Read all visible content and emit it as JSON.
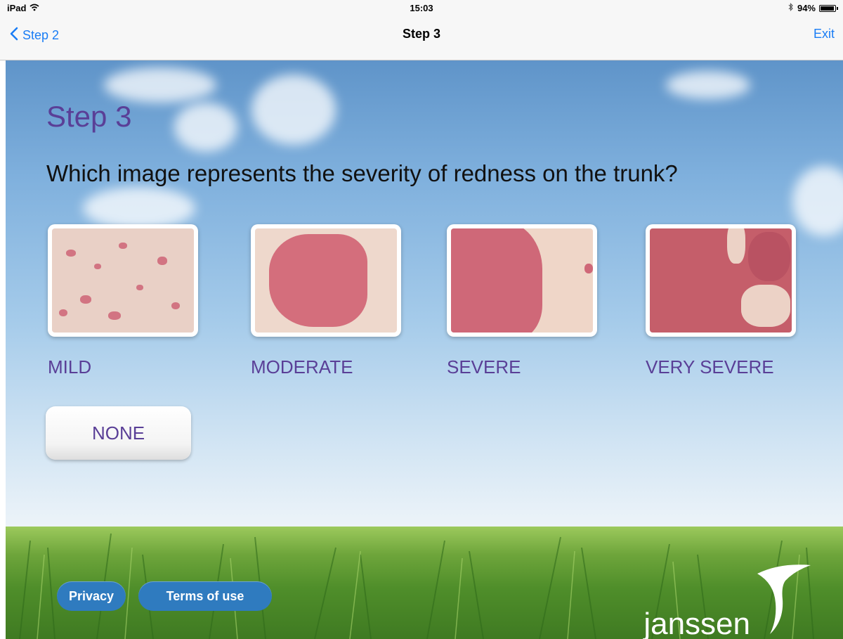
{
  "status_bar": {
    "device": "iPad",
    "time": "15:03",
    "battery": "94%",
    "battery_level": 0.94
  },
  "nav": {
    "back_label": "Step 2",
    "title": "Step 3",
    "exit_label": "Exit"
  },
  "main": {
    "heading": "Step 3",
    "question": "Which image represents the severity of redness on the trunk?",
    "options": [
      {
        "label": "MILD"
      },
      {
        "label": "MODERATE"
      },
      {
        "label": "SEVERE"
      },
      {
        "label": "VERY SEVERE"
      }
    ],
    "none_label": "NONE"
  },
  "footer": {
    "privacy_label": "Privacy",
    "terms_label": "Terms of use",
    "logo": "janssen"
  },
  "colors": {
    "accent": "#5a3f97",
    "link": "#1a7df5",
    "pill": "#2f7bbf"
  }
}
